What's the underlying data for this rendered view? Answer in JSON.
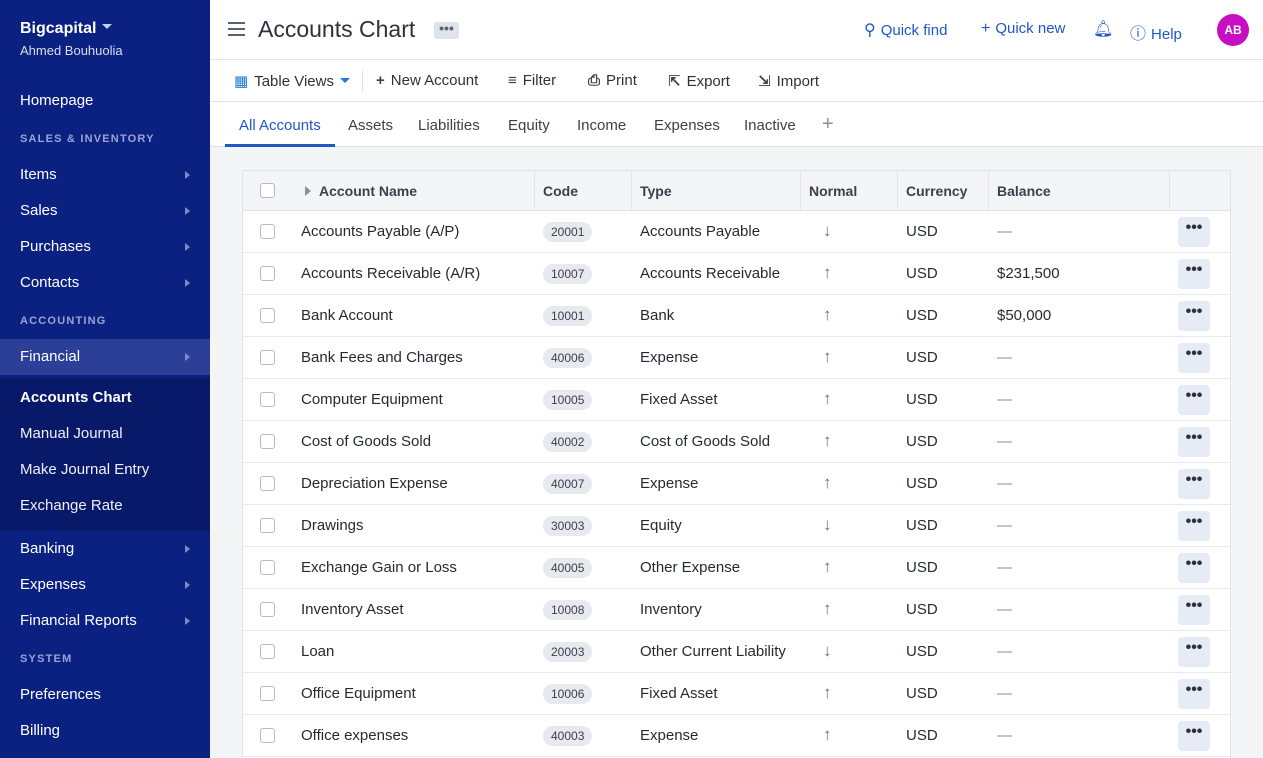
{
  "sidebar": {
    "brand": "Bigcapital",
    "user": "Ahmed Bouhuolia",
    "homepage": "Homepage",
    "section_sales": "SALES & INVENTORY",
    "items_label": "Items",
    "sales_label": "Sales",
    "purchases_label": "Purchases",
    "contacts_label": "Contacts",
    "section_accounting": "ACCOUNTING",
    "financial_label": "Financial",
    "submenu": [
      "Accounts Chart",
      "Manual Journal",
      "Make Journal Entry",
      "Exchange Rate"
    ],
    "banking_label": "Banking",
    "expenses_label": "Expenses",
    "reports_label": "Financial Reports",
    "section_system": "SYSTEM",
    "preferences_label": "Preferences",
    "billing_label": "Billing"
  },
  "header": {
    "title": "Accounts Chart",
    "more": "•••",
    "quick_find": "Quick find",
    "quick_new": "Quick new",
    "help": "Help",
    "avatar": "AB"
  },
  "toolbar": {
    "table_views": "Table Views",
    "new_account": "New Account",
    "filter": "Filter",
    "print": "Print",
    "export": "Export",
    "import": "Import"
  },
  "tabs": [
    "All Accounts",
    "Assets",
    "Liabilities",
    "Equity",
    "Income",
    "Expenses",
    "Inactive"
  ],
  "table": {
    "columns": [
      "Account Name",
      "Code",
      "Type",
      "Normal",
      "Currency",
      "Balance"
    ],
    "rows": [
      {
        "name": "Accounts Payable (A/P)",
        "code": "20001",
        "type": "Accounts Payable",
        "normal": "↓",
        "currency": "USD",
        "balance": "—"
      },
      {
        "name": "Accounts Receivable (A/R)",
        "code": "10007",
        "type": "Accounts Receivable",
        "normal": "↑",
        "currency": "USD",
        "balance": "$231,500"
      },
      {
        "name": "Bank Account",
        "code": "10001",
        "type": "Bank",
        "normal": "↑",
        "currency": "USD",
        "balance": "$50,000"
      },
      {
        "name": "Bank Fees and Charges",
        "code": "40006",
        "type": "Expense",
        "normal": "↑",
        "currency": "USD",
        "balance": "—"
      },
      {
        "name": "Computer Equipment",
        "code": "10005",
        "type": "Fixed Asset",
        "normal": "↑",
        "currency": "USD",
        "balance": "—"
      },
      {
        "name": "Cost of Goods Sold",
        "code": "40002",
        "type": "Cost of Goods Sold",
        "normal": "↑",
        "currency": "USD",
        "balance": "—"
      },
      {
        "name": "Depreciation Expense",
        "code": "40007",
        "type": "Expense",
        "normal": "↑",
        "currency": "USD",
        "balance": "—"
      },
      {
        "name": "Drawings",
        "code": "30003",
        "type": "Equity",
        "normal": "↓",
        "currency": "USD",
        "balance": "—"
      },
      {
        "name": "Exchange Gain or Loss",
        "code": "40005",
        "type": "Other Expense",
        "normal": "↑",
        "currency": "USD",
        "balance": "—"
      },
      {
        "name": "Inventory Asset",
        "code": "10008",
        "type": "Inventory",
        "normal": "↑",
        "currency": "USD",
        "balance": "—"
      },
      {
        "name": "Loan",
        "code": "20003",
        "type": "Other Current Liability",
        "normal": "↓",
        "currency": "USD",
        "balance": "—"
      },
      {
        "name": "Office Equipment",
        "code": "10006",
        "type": "Fixed Asset",
        "normal": "↑",
        "currency": "USD",
        "balance": "—"
      },
      {
        "name": "Office expenses",
        "code": "40003",
        "type": "Expense",
        "normal": "↑",
        "currency": "USD",
        "balance": "—"
      }
    ],
    "row_menu": "•••"
  },
  "colors": {
    "sidebar_bg": "#0b2182",
    "accent": "#1f57c7",
    "avatar_bg": "#c70ec2"
  }
}
